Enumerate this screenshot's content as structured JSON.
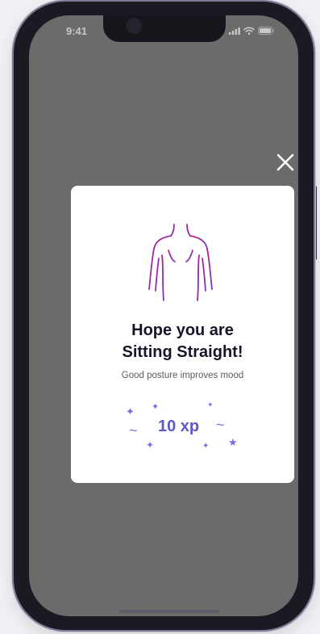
{
  "status_bar": {
    "time": "9:41",
    "icons": [
      "signal-icon",
      "wifi-icon",
      "battery-icon"
    ]
  },
  "modal": {
    "close_icon": "close-icon",
    "illustration": "posture-back-icon",
    "title_line1": "Hope you are",
    "title_line2": "Sitting Straight!",
    "subtitle": "Good posture improves mood",
    "reward": "10 xp"
  },
  "colors": {
    "overlay": "#6b6b6b",
    "card": "#ffffff",
    "title": "#161629",
    "accent": "#5c58c7",
    "illustration_gradient": [
      "#c2187a",
      "#6b3fd0"
    ]
  }
}
